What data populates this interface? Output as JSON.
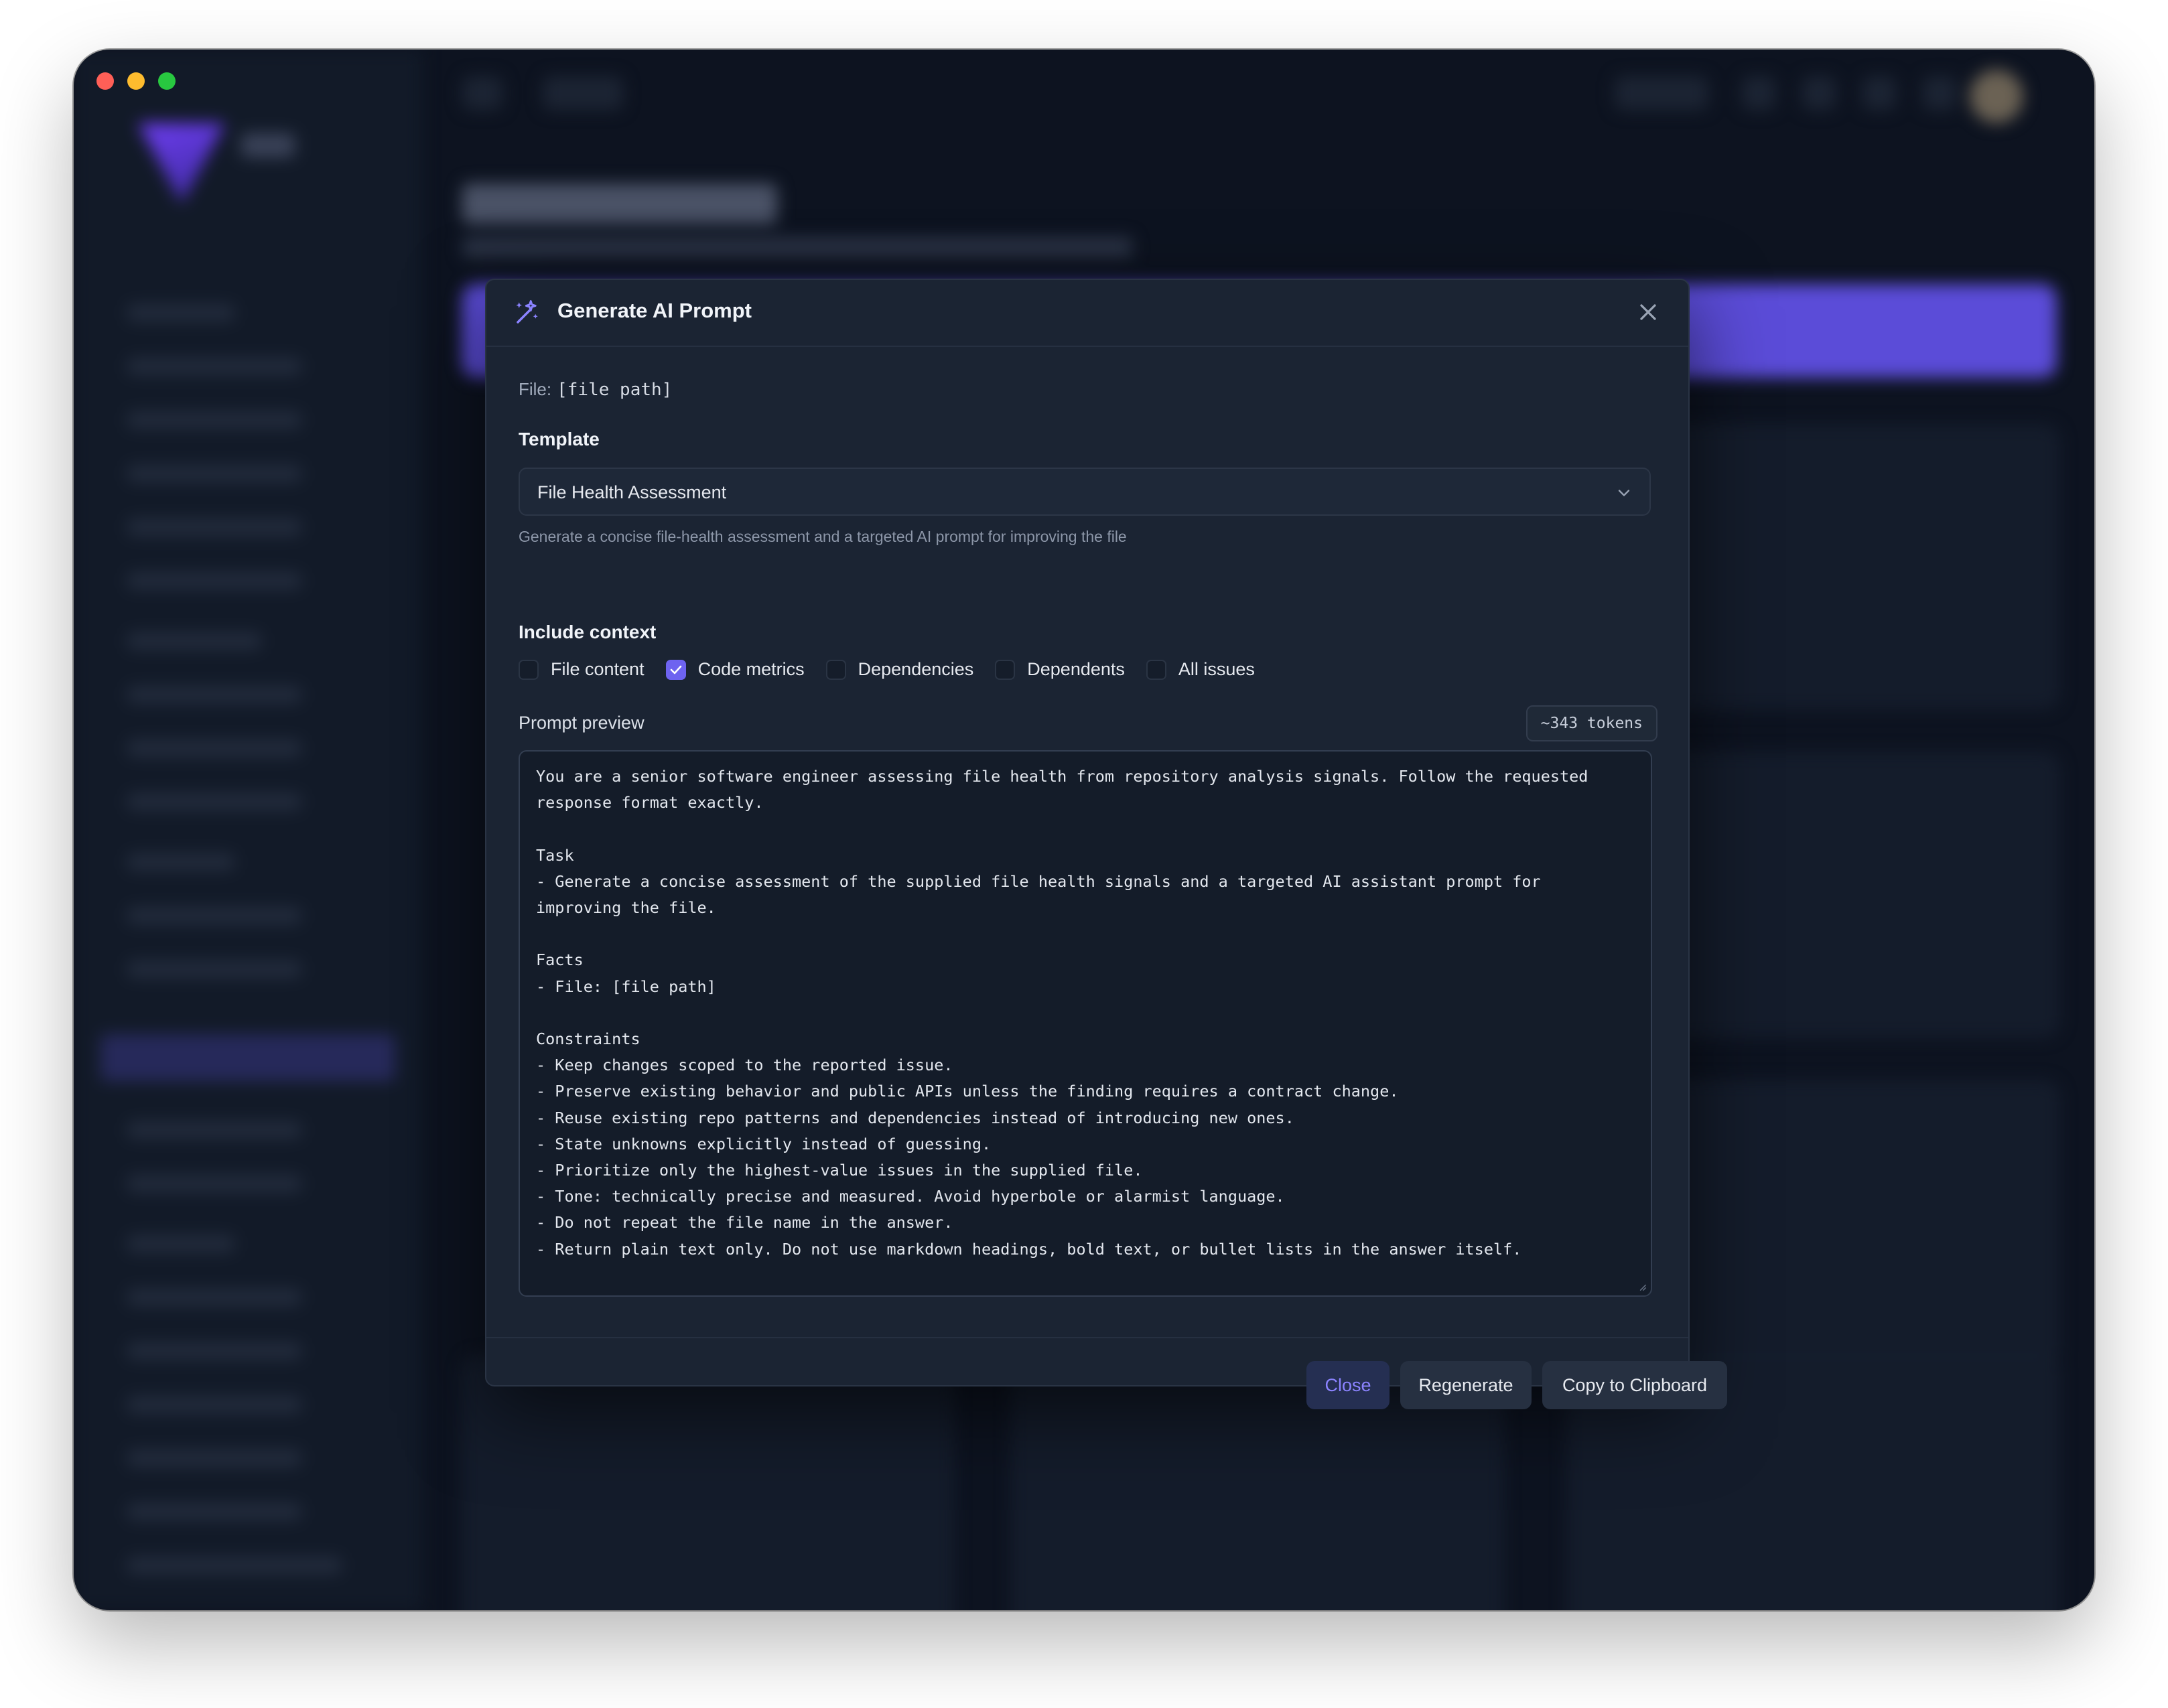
{
  "modal": {
    "title": "Generate AI Prompt",
    "file_label": "File:",
    "file_value": "[file path]",
    "template_label": "Template",
    "template_selected": "File Health Assessment",
    "template_helper": "Generate a concise file-health assessment and a targeted AI prompt for improving the file",
    "context_label": "Include context",
    "context_options": [
      {
        "label": "File content",
        "checked": false
      },
      {
        "label": "Code metrics",
        "checked": true
      },
      {
        "label": "Dependencies",
        "checked": false
      },
      {
        "label": "Dependents",
        "checked": false
      },
      {
        "label": "All issues",
        "checked": false
      }
    ],
    "preview_label": "Prompt preview",
    "token_count": "~343 tokens",
    "prompt_text": "You are a senior software engineer assessing file health from repository analysis signals. Follow the requested response format exactly.\n\nTask\n- Generate a concise assessment of the supplied file health signals and a targeted AI assistant prompt for improving the file.\n\nFacts\n- File: [file path]\n\nConstraints\n- Keep changes scoped to the reported issue.\n- Preserve existing behavior and public APIs unless the finding requires a contract change.\n- Reuse existing repo patterns and dependencies instead of introducing new ones.\n- State unknowns explicitly instead of guessing.\n- Prioritize only the highest-value issues in the supplied file.\n- Tone: technically precise and measured. Avoid hyperbole or alarmist language.\n- Do not repeat the file name in the answer.\n- Return plain text only. Do not use markdown headings, bold text, or bullet lists in the answer itself.\n\nReturn",
    "buttons": {
      "close": "Close",
      "regenerate": "Regenerate",
      "copy": "Copy to Clipboard"
    }
  },
  "colors": {
    "accent": "#6e63f0",
    "modal_bg": "#1b2433",
    "window_bg": "#0d1320"
  }
}
